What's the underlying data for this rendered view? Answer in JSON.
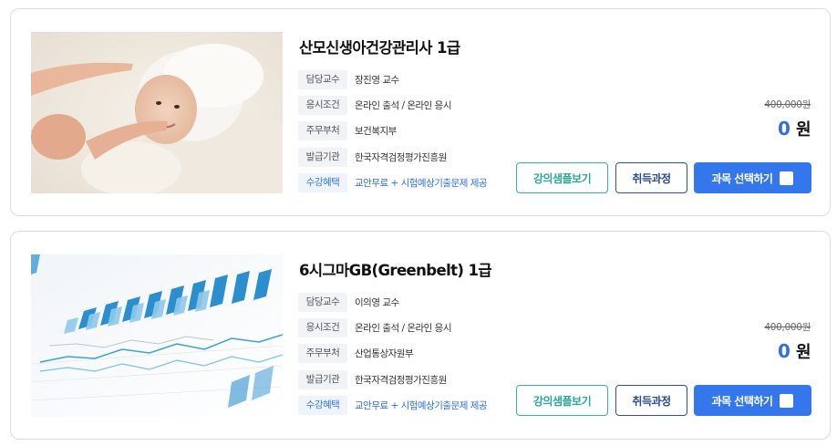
{
  "courses": [
    {
      "title": "산모신생아건강관리사 1급",
      "image": "baby-photo",
      "info": [
        {
          "label": "담당교수",
          "value": "장진영 교수"
        },
        {
          "label": "응시조건",
          "value": "온라인 출석 / 온라인 응시"
        },
        {
          "label": "주무부처",
          "value": "보건복지부"
        },
        {
          "label": "발급기관",
          "value": "한국자격검정평가진흥원"
        },
        {
          "label": "수강혜택",
          "value": "교안무료 + 시험예상기출문제 제공"
        }
      ],
      "original_price": "400,000원",
      "price": "0",
      "currency": "원",
      "buttons": {
        "sample": "강의샘플보기",
        "acquisition": "취득과정",
        "select": "과목 선택하기"
      }
    },
    {
      "title": "6시그마GB(Greenbelt) 1급",
      "image": "chart-photo",
      "info": [
        {
          "label": "담당교수",
          "value": "이의영 교수"
        },
        {
          "label": "응시조건",
          "value": "온라인 출석 / 온라인 응시"
        },
        {
          "label": "주무부처",
          "value": "산업통상자원부"
        },
        {
          "label": "발급기관",
          "value": "한국자격검정평가진흥원"
        },
        {
          "label": "수강혜택",
          "value": "교안무료 + 시험예상기출문제 제공"
        }
      ],
      "original_price": "400,000원",
      "price": "0",
      "currency": "원",
      "buttons": {
        "sample": "강의샘플보기",
        "acquisition": "취득과정",
        "select": "과목 선택하기"
      }
    }
  ],
  "colors": {
    "accent_blue": "#3477ec",
    "teal": "#35b3a6",
    "navy": "#2f4f9a",
    "benefit_text": "#2f6fe0"
  }
}
